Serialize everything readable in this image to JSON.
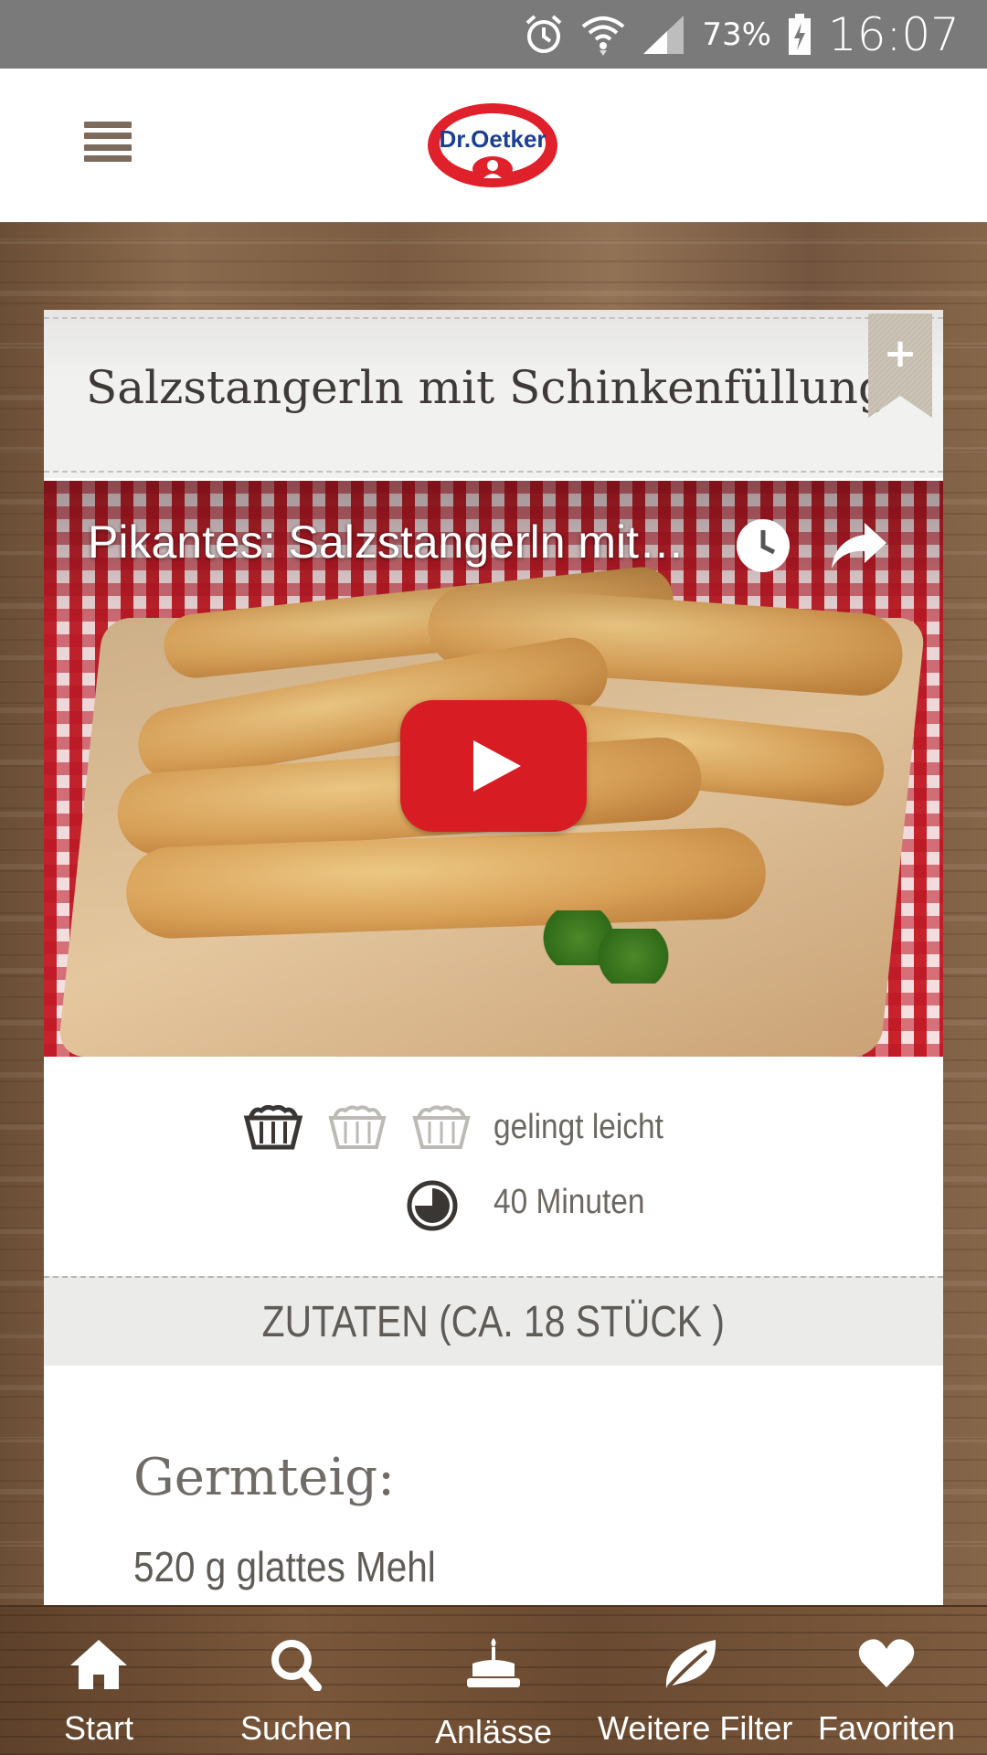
{
  "status_bar": {
    "battery_percent": "73%",
    "time": "16:07"
  },
  "header": {
    "logo_text": "Dr.Oetker"
  },
  "recipe": {
    "title": "Salzstangerln mit Schinkenfüllung",
    "bookmark_symbol": "+",
    "video": {
      "title": "Pikantes: Salzstangerln mit…"
    },
    "difficulty": {
      "level": 1,
      "max": 3,
      "label": "gelingt leicht"
    },
    "time_label": "40 Minuten",
    "ingredients_header": "ZUTATEN (CA. 18 STÜCK )",
    "ingredient_section": "Germteig:",
    "ingredients": [
      "520 g glattes Mehl"
    ]
  },
  "bottom_nav": {
    "items": [
      {
        "label": "Start",
        "icon": "home-icon"
      },
      {
        "label": "Suchen",
        "icon": "search-icon"
      },
      {
        "label": "Anlässe",
        "icon": "cake-icon"
      },
      {
        "label": "Weitere Filter",
        "icon": "leaf-icon"
      },
      {
        "label": "Favoriten",
        "icon": "heart-icon"
      }
    ]
  },
  "colors": {
    "brand_red": "#d71c24",
    "text_dark": "#3e3a37",
    "text_muted": "#6b6762"
  }
}
